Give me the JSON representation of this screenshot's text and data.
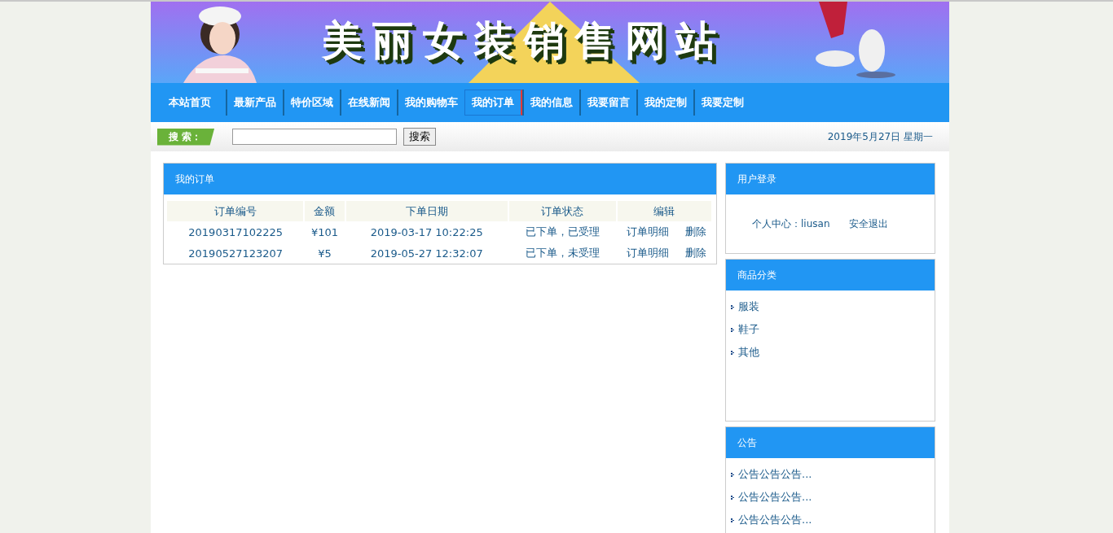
{
  "banner": {
    "title": "美丽女装销售网站"
  },
  "nav": [
    {
      "label": "本站首页",
      "selected": false
    },
    {
      "label": "最新产品",
      "selected": false
    },
    {
      "label": "特价区域",
      "selected": false
    },
    {
      "label": "在线新闻",
      "selected": false
    },
    {
      "label": "我的购物车",
      "selected": false
    },
    {
      "label": "我的订单",
      "selected": true
    },
    {
      "label": "我的信息",
      "selected": false
    },
    {
      "label": "我要留言",
      "selected": false
    },
    {
      "label": "我的定制",
      "selected": false
    },
    {
      "label": "我要定制",
      "selected": false
    }
  ],
  "search": {
    "label": "搜 索：",
    "button": "搜索",
    "date": "2019年5月27日 星期一"
  },
  "orders": {
    "title": "我的订单",
    "columns": [
      "订单编号",
      "金额",
      "下单日期",
      "订单状态",
      "编辑"
    ],
    "rows": [
      {
        "id": "20190317102225",
        "amount": "¥101",
        "date": "2019-03-17 10:22:25",
        "status": "已下单，已受理",
        "actions": [
          "订单明细",
          "删除"
        ]
      },
      {
        "id": "20190527123207",
        "amount": "¥5",
        "date": "2019-05-27 12:32:07",
        "status": "已下单，未受理",
        "actions": [
          "订单明细",
          "删除"
        ]
      }
    ]
  },
  "login": {
    "title": "用户登录",
    "user_label": "个人中心：liusan",
    "logout": "安全退出"
  },
  "categories": {
    "title": "商品分类",
    "items": [
      "服装",
      "鞋子",
      "其他"
    ]
  },
  "notices": {
    "title": "公告",
    "items": [
      "公告公告公告...",
      "公告公告公告...",
      "公告公告公告..."
    ]
  }
}
